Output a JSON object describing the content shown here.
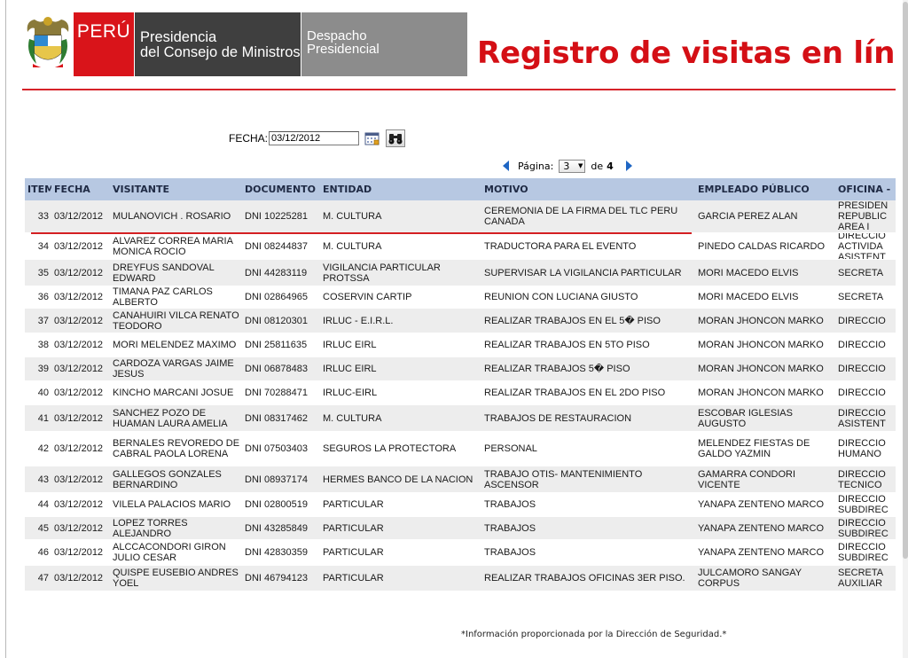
{
  "header": {
    "peru": "PERÚ",
    "pcm_line1": "Presidencia",
    "pcm_line2": "del Consejo de Ministros",
    "dp_line1": "Despacho",
    "dp_line2": "Presidencial",
    "title": "Registro de visitas en línea del D"
  },
  "filter": {
    "label": "FECHA:",
    "date_value": "03/12/2012"
  },
  "pager": {
    "page_label": "Página:",
    "current_page": "3",
    "of_label": "de",
    "total_pages": "4"
  },
  "table": {
    "headers": [
      "ITEM",
      "FECHA",
      "VISITANTE",
      "DOCUMENTO",
      "ENTIDAD",
      "MOTIVO",
      "EMPLEADO PÚBLICO",
      "OFICINA -"
    ],
    "rows": [
      [
        "33",
        "03/12/2012",
        "MULANOVICH . ROSARIO",
        "DNI 10225281",
        "M. CULTURA",
        "CEREMONIA DE LA FIRMA DEL TLC PERU CANADA",
        "GARCIA PEREZ ALAN",
        "PRESIDEN REPUBLIC AREA I"
      ],
      [
        "34",
        "03/12/2012",
        "ALVAREZ CORREA MARIA MONICA ROCIO",
        "DNI 08244837",
        "M. CULTURA",
        "TRADUCTORA PARA EL EVENTO",
        "PINEDO CALDAS RICARDO",
        "DIRECCIO ACTIVIDA ASISTENT"
      ],
      [
        "35",
        "03/12/2012",
        "DREYFUS SANDOVAL EDWARD",
        "DNI 44283119",
        "VIGILANCIA PARTICULAR PROTSSA",
        "SUPERVISAR LA VIGILANCIA PARTICULAR",
        "MORI MACEDO ELVIS",
        "SECRETA"
      ],
      [
        "36",
        "03/12/2012",
        "TIMANA PAZ CARLOS ALBERTO",
        "DNI 02864965",
        "COSERVIN CARTIP",
        "REUNION CON LUCIANA GIUSTO",
        "MORI MACEDO ELVIS",
        "SECRETA"
      ],
      [
        "37",
        "03/12/2012",
        "CANAHUIRI VILCA RENATO TEODORO",
        "DNI 08120301",
        "IRLUC - E.I.R.L.",
        "REALIZAR TRABAJOS EN EL 5� PISO",
        "MORAN JHONCON MARKO",
        "DIRECCIO"
      ],
      [
        "38",
        "03/12/2012",
        "MORI MELENDEZ MAXIMO",
        "DNI 25811635",
        "IRLUC EIRL",
        "REALIZAR TRABAJOS EN 5TO PISO",
        "MORAN JHONCON MARKO",
        "DIRECCIO"
      ],
      [
        "39",
        "03/12/2012",
        "CARDOZA VARGAS JAIME JESUS",
        "DNI 06878483",
        "IRLUC EIRL",
        "REALIZAR TRABAJOS 5� PISO",
        "MORAN JHONCON MARKO",
        "DIRECCIO"
      ],
      [
        "40",
        "03/12/2012",
        "KINCHO MARCANI JOSUE",
        "DNI 70288471",
        "IRLUC-EIRL",
        "REALIZAR TRABAJOS EN EL 2DO PISO",
        "MORAN JHONCON MARKO",
        "DIRECCIO"
      ],
      [
        "41",
        "03/12/2012",
        "SANCHEZ POZO DE HUAMAN LAURA AMELIA",
        "DNI 08317462",
        "M. CULTURA",
        "TRABAJOS DE RESTAURACION",
        "ESCOBAR IGLESIAS AUGUSTO",
        "DIRECCIO ASISTENT"
      ],
      [
        "42",
        "03/12/2012",
        "BERNALES REVOREDO DE CABRAL PAOLA LORENA",
        "DNI 07503403",
        "SEGUROS LA PROTECTORA",
        "PERSONAL",
        "MELENDEZ FIESTAS DE GALDO YAZMIN",
        "DIRECCIO HUMANO"
      ],
      [
        "43",
        "03/12/2012",
        "GALLEGOS GONZALES BERNARDINO",
        "DNI 08937174",
        "HERMES BANCO DE LA NACION",
        "TRABAJO OTIS- MANTENIMIENTO ASCENSOR",
        "GAMARRA CONDORI VICENTE",
        "DIRECCIO TECNICO"
      ],
      [
        "44",
        "03/12/2012",
        "VILELA PALACIOS MARIO",
        "DNI 02800519",
        "PARTICULAR",
        "TRABAJOS",
        "YANAPA ZENTENO MARCO",
        "DIRECCIO SUBDIREC"
      ],
      [
        "45",
        "03/12/2012",
        "LOPEZ TORRES ALEJANDRO",
        "DNI 43285849",
        "PARTICULAR",
        "TRABAJOS",
        "YANAPA ZENTENO MARCO",
        "DIRECCIO SUBDIREC"
      ],
      [
        "46",
        "03/12/2012",
        "ALCCACONDORI GIRON JULIO CESAR",
        "DNI 42830359",
        "PARTICULAR",
        "TRABAJOS",
        "YANAPA ZENTENO MARCO",
        "DIRECCIO SUBDIREC"
      ],
      [
        "47",
        "03/12/2012",
        "QUISPE EUSEBIO ANDRES YOEL",
        "DNI 46794123",
        "PARTICULAR",
        "REALIZAR TRABAJOS OFICINAS 3ER PISO.",
        "JULCAMORO SANGAY CORPUS",
        "SECRETA AUXILIAR"
      ]
    ]
  },
  "footnote": "*Información proporcionada por la Dirección de Seguridad.*",
  "colors": {
    "brand_red": "#d9141a",
    "title_red": "#d40f15",
    "header_blue": "#b7c8e2",
    "arrow_blue": "#1f66c4"
  },
  "icons": {
    "emblem": "peru-coat-of-arms-icon",
    "calendar": "calendar-icon",
    "search": "binoculars-icon"
  }
}
